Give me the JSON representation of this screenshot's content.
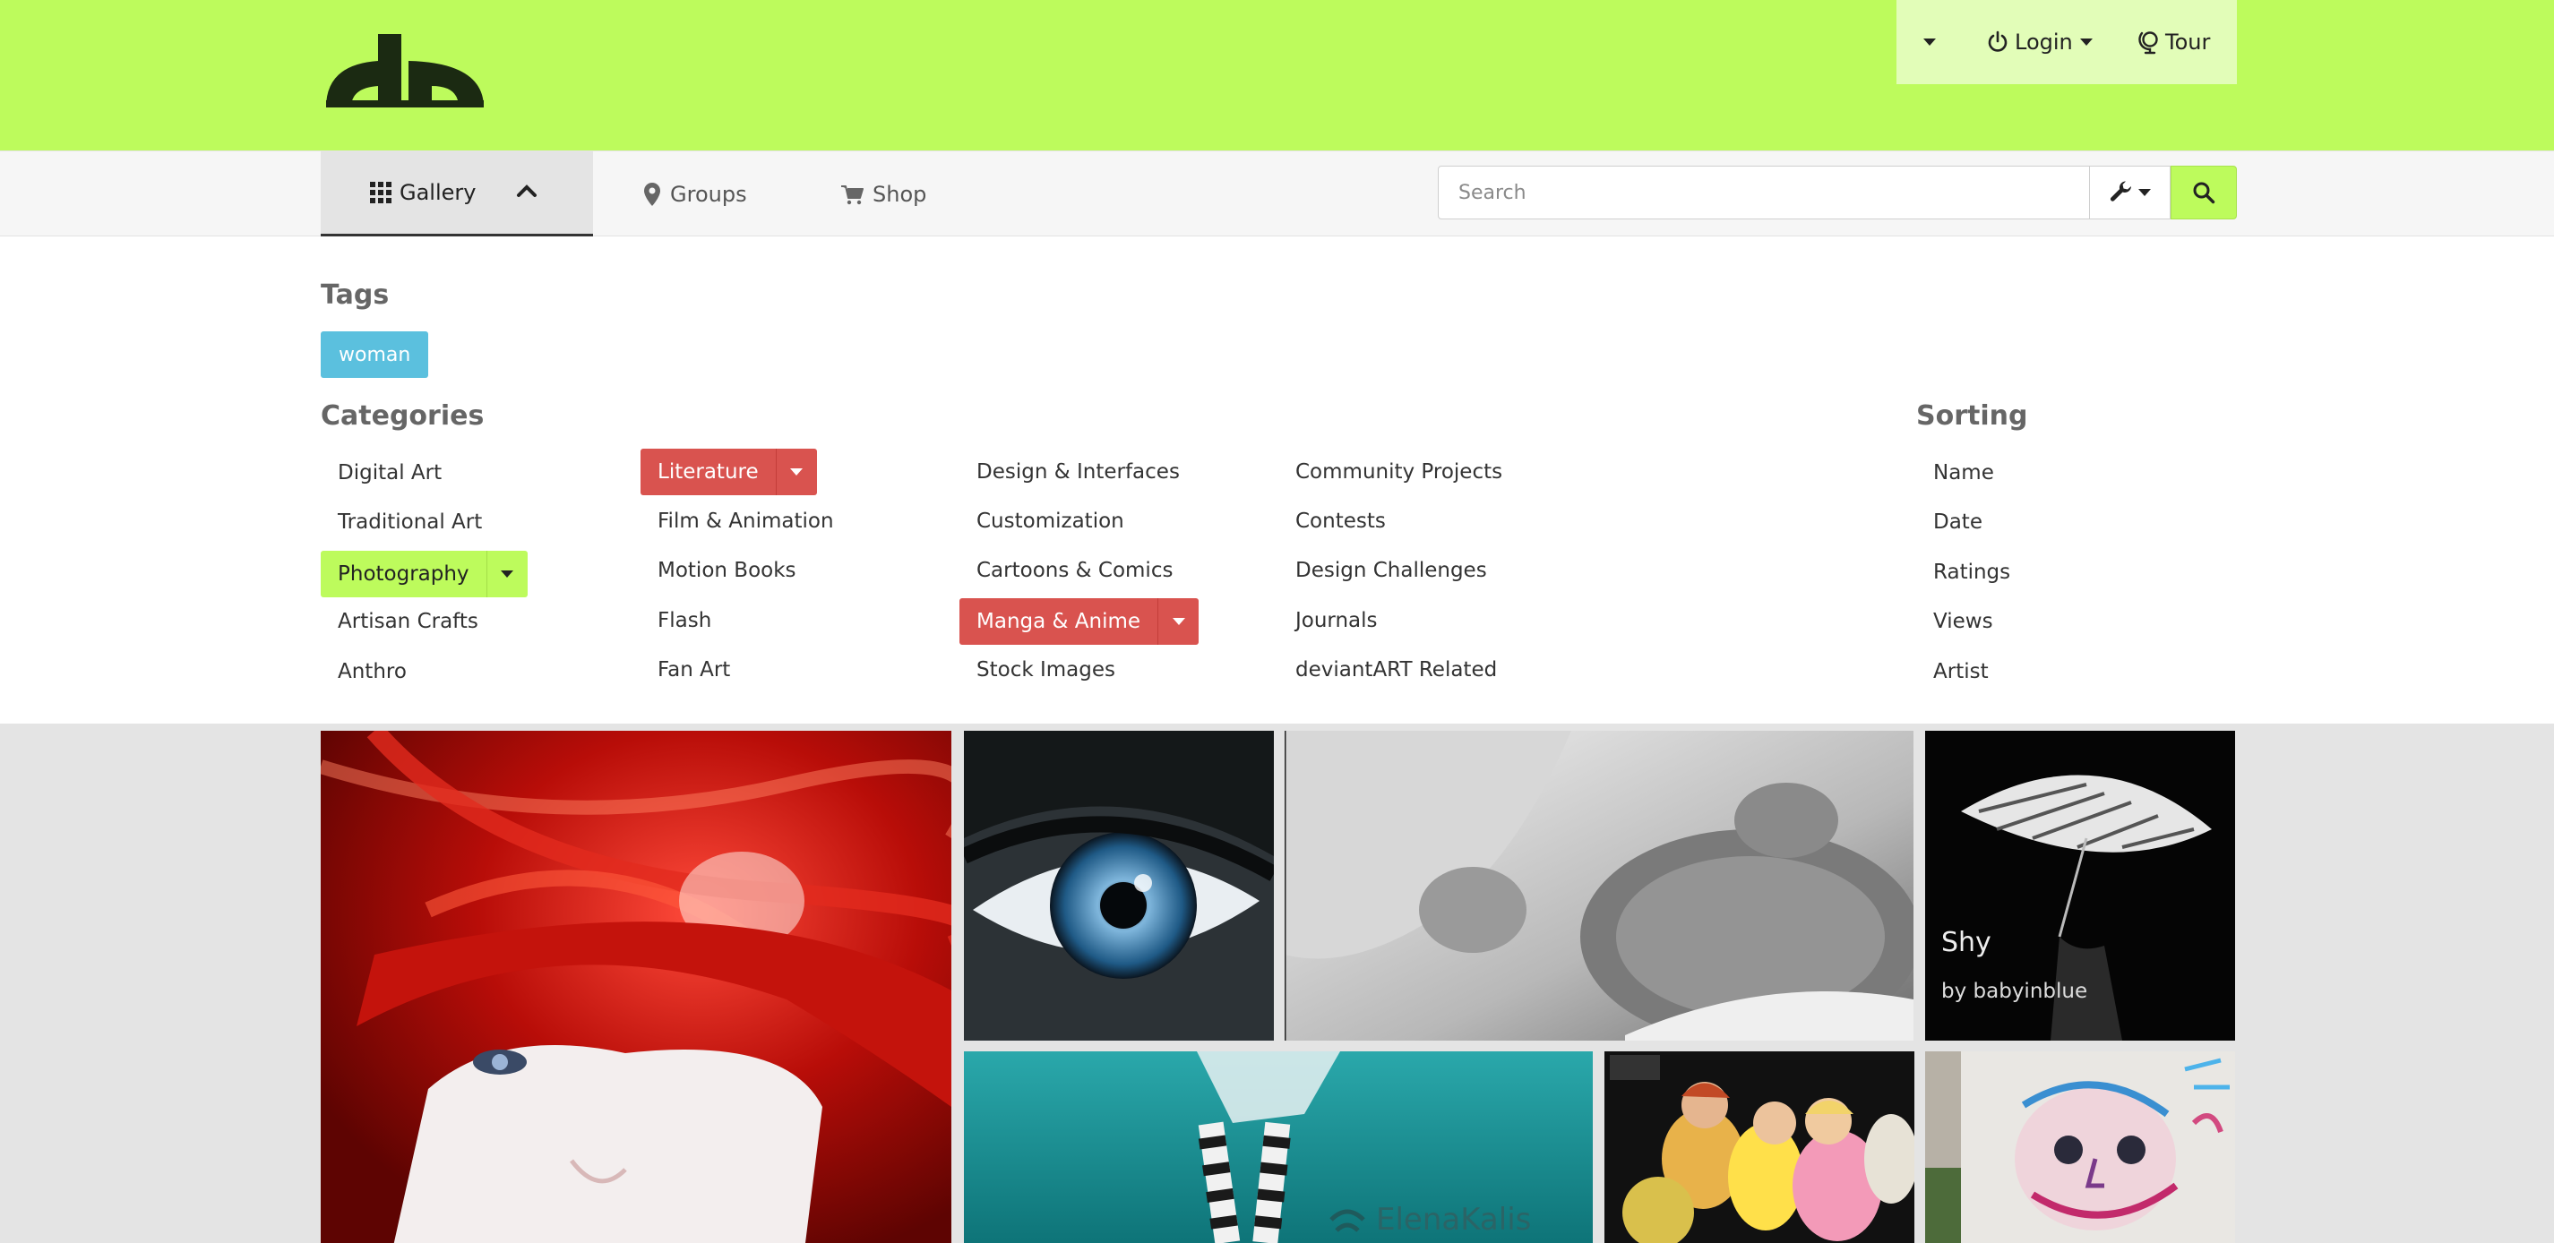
{
  "topbar": {
    "brand_color": "#bdfb5c",
    "logo_icon": "deviantart-logo",
    "user_menu": {
      "caret_icon": "caret-down-icon",
      "login_label": "Login",
      "login_icon": "power-icon",
      "tour_label": "Tour",
      "tour_icon": "globe-icon"
    }
  },
  "nav": {
    "gallery_label": "Gallery",
    "gallery_icon": "grid-icon",
    "groups_label": "Groups",
    "groups_icon": "map-marker-icon",
    "shop_label": "Shop",
    "shop_icon": "cart-icon",
    "search_placeholder": "Search",
    "search_value": "",
    "tools_icon": "wrench-icon",
    "search_icon": "search-icon"
  },
  "filters": {
    "tags_heading": "Tags",
    "tags": [
      "woman"
    ],
    "categories_heading": "Categories",
    "categories_col1": [
      "Digital Art",
      "Traditional Art",
      "Photography",
      "Artisan Crafts",
      "Anthro"
    ],
    "categories_col2": [
      "Literature",
      "Film & Animation",
      "Motion Books",
      "Flash",
      "Fan Art"
    ],
    "categories_col3": [
      "Design & Interfaces",
      "Customization",
      "Cartoons & Comics",
      "Manga & Anime",
      "Stock Images"
    ],
    "categories_col4": [
      "Community Projects",
      "Contests",
      "Design Challenges",
      "Journals",
      "deviantART Related"
    ],
    "sorting_heading": "Sorting",
    "sorting": [
      "Name",
      "Date",
      "Ratings",
      "Views",
      "Artist"
    ],
    "active_colors": {
      "photography": "#bdfb5c",
      "literature": "#d9534f",
      "manga": "#d9534f",
      "tag": "#5bc0de"
    }
  },
  "gallery": {
    "tiles": [
      {
        "subject": "red-hair-portrait"
      },
      {
        "subject": "blue-eye-closeup"
      },
      {
        "subject": "kitten-sleeping"
      },
      {
        "subject": "umbrella-woman",
        "title": "Shy",
        "byline": "by babyinblue"
      },
      {
        "subject": "underwater-legs",
        "watermark": "ElenaKalis"
      },
      {
        "subject": "princess-group"
      },
      {
        "subject": "graffiti-face"
      }
    ]
  }
}
